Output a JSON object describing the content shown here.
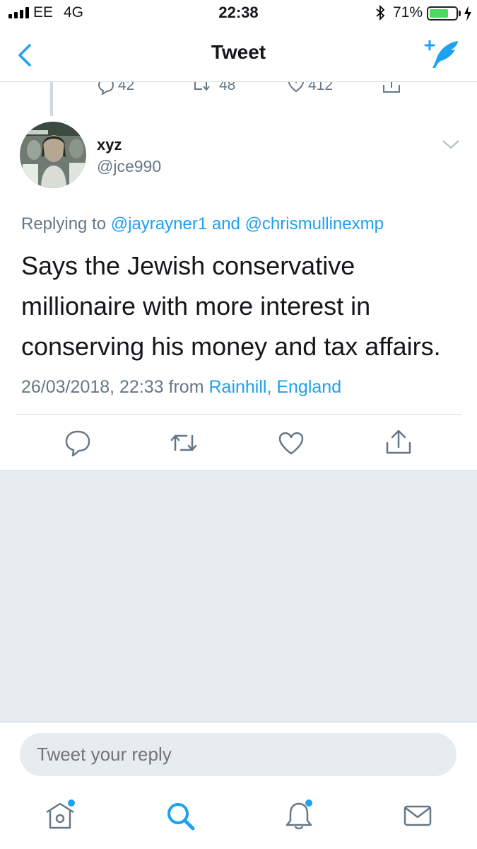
{
  "status_bar": {
    "carrier": "EE",
    "network": "4G",
    "time": "22:38",
    "battery_percent": "71%",
    "battery_level": 0.71,
    "icons": [
      "signal-bars-icon",
      "bluetooth-icon",
      "battery-icon",
      "charging-bolt-icon"
    ]
  },
  "nav": {
    "title": "Tweet",
    "back_icon": "chevron-left-icon",
    "compose_icon": "compose-tweet-icon"
  },
  "previous_tweet": {
    "replies": "42",
    "retweets": "48",
    "likes": "412"
  },
  "tweet": {
    "display_name": "xyz",
    "handle": "@jce990",
    "replying_prefix": "Replying to",
    "replying_to_1": "@jayrayner1",
    "replying_joiner": "and",
    "replying_to_2": "@chrismullinexmp",
    "text": "Says the Jewish conservative millionaire with more interest in conserving his money and tax affairs.",
    "timestamp": "26/03/2018, 22:33",
    "from_label": "from",
    "location": "Rainhill, England"
  },
  "actions": [
    "reply-icon",
    "retweet-icon",
    "like-icon",
    "share-icon"
  ],
  "reply_box": {
    "placeholder": "Tweet your reply"
  },
  "tab_bar": [
    "home-icon",
    "search-icon",
    "notifications-icon",
    "messages-icon"
  ],
  "colors": {
    "accent": "#1da1f2",
    "secondary_text": "#657786",
    "panel_background": "#e6ecf0",
    "battery_green": "#4cd964"
  }
}
